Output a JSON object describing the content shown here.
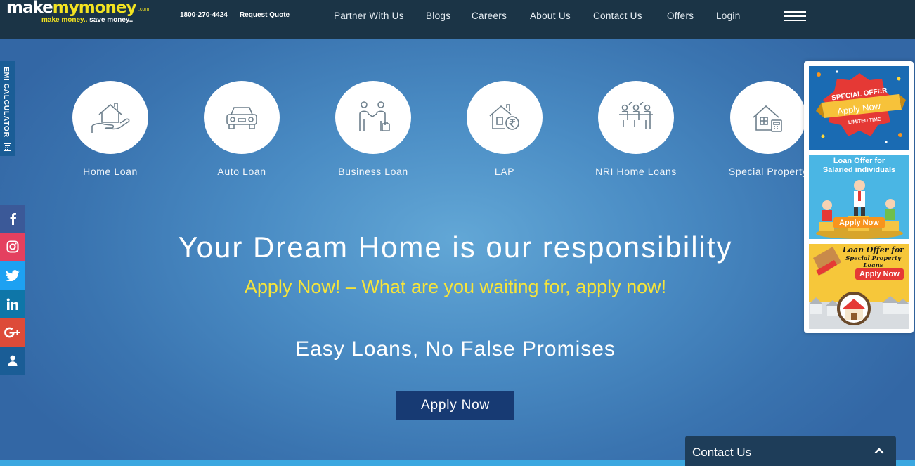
{
  "header": {
    "logo": {
      "part1": "make",
      "part2": "mymoney",
      "tld": ".com",
      "tagline_a": "make money..",
      "tagline_b": " save money.."
    },
    "phone": "1800-270-4424",
    "request_quote": "Request Quote",
    "nav": [
      "Partner With Us",
      "Blogs",
      "Careers",
      "About Us",
      "Contact Us",
      "Offers",
      "Login"
    ]
  },
  "emi_tab": {
    "label": "EMI CALCULATOR",
    "icon": "calculator-icon"
  },
  "social": [
    {
      "name": "facebook-icon",
      "color": "#3b5998"
    },
    {
      "name": "instagram-icon",
      "color": "#e4405f"
    },
    {
      "name": "twitter-icon",
      "color": "#1da1f2"
    },
    {
      "name": "linkedin-icon",
      "color": "#0e76a8"
    },
    {
      "name": "google-plus-icon",
      "color": "#dd4b39"
    },
    {
      "name": "user-icon",
      "color": "#1a5d96"
    }
  ],
  "categories": [
    {
      "label": "Home Loan",
      "icon": "home-loan-icon"
    },
    {
      "label": "Auto Loan",
      "icon": "car-icon"
    },
    {
      "label": "Business Loan",
      "icon": "business-handshake-icon"
    },
    {
      "label": "LAP",
      "icon": "property-rupee-icon"
    },
    {
      "label": "NRI Home Loans",
      "icon": "nri-people-icon"
    },
    {
      "label": "Special Property",
      "icon": "special-property-icon"
    }
  ],
  "hero": {
    "title": "Your Dream Home is our responsibility",
    "subtitle": "Apply Now! – What are you waiting for, apply now!",
    "tagline": "Easy Loans, No False Promises",
    "cta": "Apply Now"
  },
  "offers": [
    {
      "line1": "SPECIAL OFFER",
      "line2": "Apply Now",
      "line3": "LIMITED TIME"
    },
    {
      "line1": "Loan Offer for",
      "line2": "Salaried individuals",
      "cta": "Apply Now"
    },
    {
      "line1": "Loan Offer for",
      "line2": "Special Property Loans",
      "cta": "Apply Now"
    }
  ],
  "contact_bar": {
    "label": "Contact Us"
  },
  "colors": {
    "header_bg": "#1b3446",
    "accent_yellow": "#f6e43a",
    "button_navy": "#173a73",
    "offer_orange": "#f7941d"
  }
}
